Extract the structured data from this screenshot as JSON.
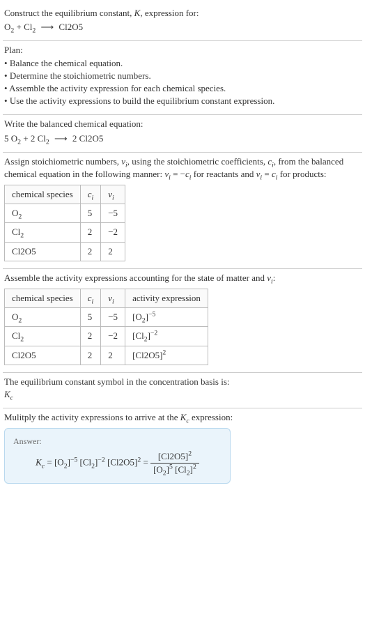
{
  "intro": {
    "line1_a": "Construct the equilibrium constant, ",
    "K": "K",
    "line1_b": ", expression for:"
  },
  "unbalanced": {
    "r1": "O",
    "r1sub": "2",
    "plus": " + ",
    "r2": "Cl",
    "r2sub": "2",
    "arrow": "⟶",
    "p1": "Cl",
    "p1f": "2O5"
  },
  "plan": {
    "title": "Plan:",
    "b1": "Balance the chemical equation.",
    "b2": "Determine the stoichiometric numbers.",
    "b3": "Assemble the activity expression for each chemical species.",
    "b4": "Use the activity expressions to build the equilibrium constant expression."
  },
  "balanced_label": "Write the balanced chemical equation:",
  "balanced": {
    "c1": "5 ",
    "r1": "O",
    "r1sub": "2",
    "plus1": " + ",
    "c2": "2 ",
    "r2": "Cl",
    "r2sub": "2",
    "arrow": "⟶",
    "c3": " 2 ",
    "p1": "Cl",
    "p1f": "2O5"
  },
  "assign": {
    "t1": "Assign stoichiometric numbers, ",
    "nu": "ν",
    "sub_i": "i",
    "t2": ", using the stoichiometric coefficients, ",
    "c": "c",
    "t3": ", from the balanced chemical equation in the following manner: ",
    "eq1a": "ν",
    "eq1b": " = −",
    "eq1c": "c",
    "t4": " for reactants and ",
    "eq2a": "ν",
    "eq2b": " = ",
    "eq2c": "c",
    "t5": " for products:"
  },
  "table1": {
    "h1": "chemical species",
    "h2": "c",
    "h2sub": "i",
    "h3": "ν",
    "h3sub": "i",
    "rows": [
      {
        "sp_a": "O",
        "sp_sub": "2",
        "c": "5",
        "nu": "−5"
      },
      {
        "sp_a": "Cl",
        "sp_sub": "2",
        "c": "2",
        "nu": "−2"
      },
      {
        "sp_a": "Cl",
        "sp_sub": "2O5",
        "c": "2",
        "nu": "2"
      }
    ]
  },
  "assemble": {
    "t1": "Assemble the activity expressions accounting for the state of matter and ",
    "nu": "ν",
    "sub_i": "i",
    "t2": ":"
  },
  "table2": {
    "h1": "chemical species",
    "h2": "c",
    "h2sub": "i",
    "h3": "ν",
    "h3sub": "i",
    "h4": "activity expression",
    "rows": [
      {
        "sp_a": "O",
        "sp_sub": "2",
        "c": "5",
        "nu": "−5",
        "ae_a": "[O",
        "ae_sub": "2",
        "ae_b": "]",
        "ae_sup": "−5"
      },
      {
        "sp_a": "Cl",
        "sp_sub": "2",
        "c": "2",
        "nu": "−2",
        "ae_a": "[Cl",
        "ae_sub": "2",
        "ae_b": "]",
        "ae_sup": "−2"
      },
      {
        "sp_a": "Cl",
        "sp_sub": "2O5",
        "c": "2",
        "nu": "2",
        "ae_a": "[Cl",
        "ae_sub": "2O5",
        "ae_b": "]",
        "ae_sup": "2"
      }
    ]
  },
  "symbol": {
    "t1": "The equilibrium constant symbol in the concentration basis is:",
    "K": "K",
    "sub": "c"
  },
  "mult": {
    "t1": "Mulitply the activity expressions to arrive at the ",
    "K": "K",
    "sub": "c",
    "t2": " expression:"
  },
  "answer": {
    "label": "Answer:",
    "Kc_K": "K",
    "Kc_sub": "c",
    "eq": " = ",
    "term1_a": "[O",
    "term1_sub": "2",
    "term1_b": "]",
    "term1_sup": "−5",
    "term2_a": " [Cl",
    "term2_sub": "2",
    "term2_b": "]",
    "term2_sup": "−2",
    "term3_a": " [Cl",
    "term3_sub": "2O5",
    "term3_b": "]",
    "term3_sup": "2",
    "eq2": " = ",
    "num_a": "[Cl",
    "num_sub": "2O5",
    "num_b": "]",
    "num_sup": "2",
    "den1_a": "[O",
    "den1_sub": "2",
    "den1_b": "]",
    "den1_sup": "5",
    "den2_a": " [Cl",
    "den2_sub": "2",
    "den2_b": "]",
    "den2_sup": "2"
  }
}
